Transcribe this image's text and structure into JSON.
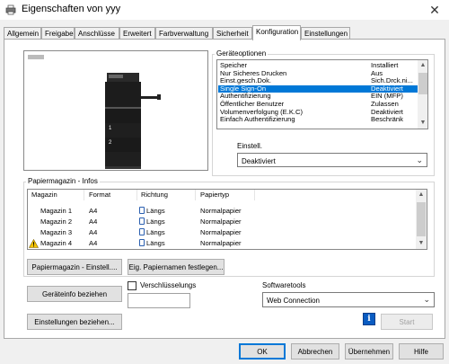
{
  "window": {
    "title": "Eigenschaften von yyy",
    "icon": "printer-icon",
    "close_glyph": "✕"
  },
  "tabs": [
    {
      "label": "Allgemein",
      "active": false
    },
    {
      "label": "Freigabe",
      "active": false
    },
    {
      "label": "Anschlüsse",
      "active": false
    },
    {
      "label": "Erweitert",
      "active": false
    },
    {
      "label": "Farbverwaltung",
      "active": false
    },
    {
      "label": "Sicherheit",
      "active": false
    },
    {
      "label": "Konfiguration",
      "active": true
    },
    {
      "label": "Einstellungen",
      "active": false
    }
  ],
  "preview": {
    "tray_labels": [
      "1",
      "2"
    ]
  },
  "device_options": {
    "label": "Geräteoptionen",
    "items": [
      {
        "name": "Speicher",
        "value": "Installiert"
      },
      {
        "name": "Nur Sicheres Drucken",
        "value": "Aus"
      },
      {
        "name": "Einst.gesch.Dok.",
        "value": "Sich.Drck.ni..."
      },
      {
        "name": "Single Sign-On",
        "value": "Deaktiviert"
      },
      {
        "name": "Authentifizierung",
        "value": "EIN (MFP)"
      },
      {
        "name": "Öffentlicher Benutzer",
        "value": "Zulassen"
      },
      {
        "name": "Volumenverfolgung (E.K.C)",
        "value": "Deaktiviert"
      },
      {
        "name": "Einfach Authentifizierung",
        "value": "Beschränk"
      }
    ],
    "selected_index": 3,
    "setting_label": "Einstell.",
    "setting_value": "Deaktiviert"
  },
  "paper_tray_info": {
    "label": "Papiermagazin - Infos",
    "columns": [
      "Magazin",
      "Format",
      "Richtung",
      "Papiertyp"
    ],
    "rows": [
      {
        "tray": "Magazin 1",
        "format": "A4",
        "direction": "Längs",
        "type": "Normalpapier",
        "warning": false
      },
      {
        "tray": "Magazin 2",
        "format": "A4",
        "direction": "Längs",
        "type": "Normalpapier",
        "warning": false
      },
      {
        "tray": "Magazin 3",
        "format": "A4",
        "direction": "Längs",
        "type": "Normalpapier",
        "warning": false
      },
      {
        "tray": "Magazin 4",
        "format": "A4",
        "direction": "Längs",
        "type": "Normalpapier",
        "warning": true
      }
    ],
    "settings_button": "Papiermagazin - Einstell....",
    "paper_names_button": "Eig. Papiernamen festlegen..."
  },
  "device_info_button": "Geräteinfo beziehen",
  "encryption": {
    "label": "Verschlüsselungs",
    "checked": false,
    "value": ""
  },
  "settings_button": "Einstellungen beziehen...",
  "software_tools": {
    "label": "Softwaretools",
    "value": "Web Connection",
    "start_button": "Start"
  },
  "footer": {
    "ok": "OK",
    "cancel": "Abbrechen",
    "apply": "Übernehmen",
    "help": "Hilfe"
  },
  "colors": {
    "accent": "#0078d7",
    "warning": "#f5c400"
  }
}
